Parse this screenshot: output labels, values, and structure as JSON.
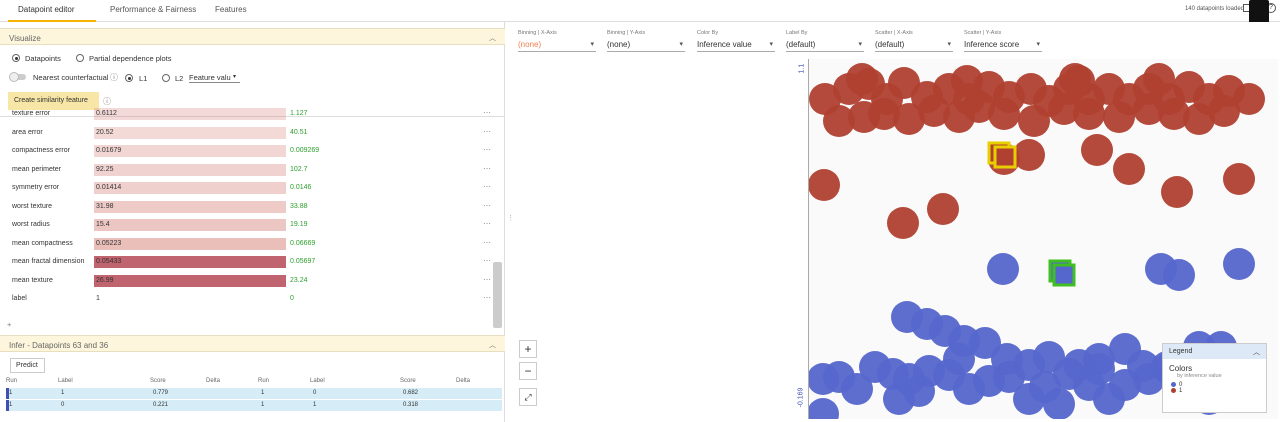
{
  "tabs": [
    "Datapoint editor",
    "Performance & Fairness",
    "Features"
  ],
  "datapoints_loaded": "140 datapoints loaded",
  "visualize": {
    "title": "Visualize",
    "opt_datapoints": "Datapoints",
    "opt_pdp": "Partial dependence plots",
    "nearest": "Nearest counterfactual",
    "l1": "L1",
    "l2": "L2",
    "feature_select": "Feature valu",
    "similarity_btn": "Create similarity feature"
  },
  "features": [
    {
      "name": "texture error",
      "v1": "0.6112",
      "v2": "1.127",
      "sel": "0.04"
    },
    {
      "name": "area error",
      "v1": "20.52",
      "v2": "40.51",
      "sel": "0.05"
    },
    {
      "name": "compactness error",
      "v1": "0.01679",
      "v2": "0.009269",
      "sel": "0.1"
    },
    {
      "name": "mean perimeter",
      "v1": "92.25",
      "v2": "102.7",
      "sel": "0.15"
    },
    {
      "name": "symmetry error",
      "v1": "0.01414",
      "v2": "0.0146",
      "sel": "0.2"
    },
    {
      "name": "worst texture",
      "v1": "31.98",
      "v2": "33.88",
      "sel": "0.28"
    },
    {
      "name": "worst radius",
      "v1": "15.4",
      "v2": "19.19",
      "sel": "0.35"
    },
    {
      "name": "mean compactness",
      "v1": "0.05223",
      "v2": "0.06669",
      "sel": "0.45"
    },
    {
      "name": "mean fractal dimension",
      "v1": "0.05433",
      "v2": "0.05697",
      "sel": "0.8"
    },
    {
      "name": "mean texture",
      "v1": "26.99",
      "v2": "23.24",
      "sel": "0.85"
    },
    {
      "name": "label",
      "v1": "1",
      "v2": "0",
      "sel": "0"
    }
  ],
  "add_label": "+",
  "infer": {
    "title": "Infer - Datapoints 63 and 36",
    "predict": "Predict",
    "headers": [
      "Run",
      "Label",
      "Score",
      "Delta",
      "Run",
      "Label",
      "Score",
      "Delta"
    ],
    "rows": [
      [
        "1",
        "1",
        "0.779",
        "",
        "1",
        "0",
        "0.682",
        ""
      ],
      [
        "1",
        "0",
        "0.221",
        "",
        "1",
        "1",
        "0.318",
        ""
      ]
    ]
  },
  "controls": [
    {
      "cap": "Binning | X-Axis",
      "val": "(none)",
      "dim": true
    },
    {
      "cap": "Binning | Y-Axis",
      "val": "(none)",
      "dim": false
    },
    {
      "cap": "Color By",
      "val": "Inference value",
      "dim": false
    },
    {
      "cap": "Label By",
      "val": "(default)",
      "dim": false
    },
    {
      "cap": "Scatter | X-Axis",
      "val": "(default)",
      "dim": false
    },
    {
      "cap": "Scatter | Y-Axis",
      "val": "Inference score",
      "dim": false
    }
  ],
  "yaxis": {
    "top": "1.1",
    "bottom": "-0.169"
  },
  "legend": {
    "title": "Legend",
    "colors": "Colors",
    "by": "by inference value",
    "items": [
      {
        "label": "0",
        "color": "#5566cc"
      },
      {
        "label": "1",
        "color": "#b04030"
      }
    ]
  },
  "colors": {
    "red": "#b04030",
    "blue": "#5566cc",
    "accent": "#f4b400"
  }
}
